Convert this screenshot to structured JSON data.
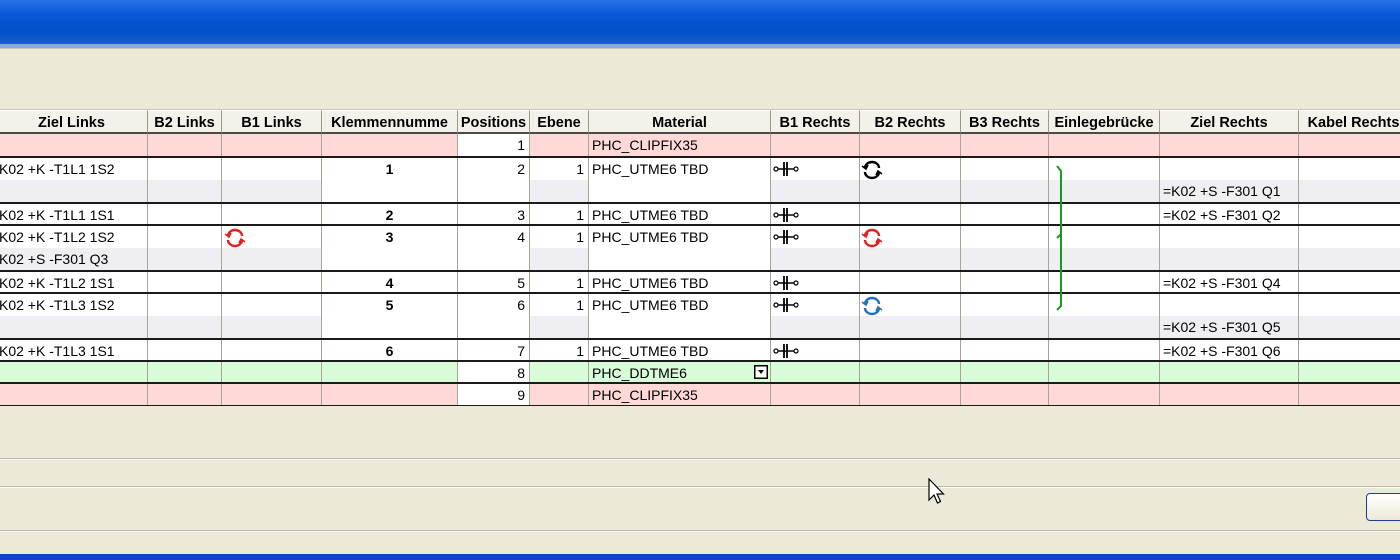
{
  "columns": [
    "Ziel Links",
    "B2 Links",
    "B1 Links",
    "Klemmennumme",
    "Positions",
    "Ebene",
    "Material",
    "B1 Rechts",
    "B2 Rechts",
    "B3 Rechts",
    "Einlegebrücke",
    "Ziel Rechts",
    "Kabel Rechts"
  ],
  "rows": [
    {
      "type": "pink",
      "position": "1",
      "material": "PHC_CLIPFIX35"
    },
    {
      "type": "terminal",
      "ziel_links": [
        "K02 +K -T1L1 1S2",
        ""
      ],
      "klemme": "1",
      "position": "2",
      "ebene": "1",
      "material": "PHC_UTME6 TBD",
      "ziel_rechts": [
        "",
        "=K02 +S -F301 Q1"
      ],
      "b2_rechts_icon": "black-jumper-icon"
    },
    {
      "type": "terminal",
      "ziel_links": [
        "K02 +K -T1L1 1S1"
      ],
      "klemme": "2",
      "position": "3",
      "ebene": "1",
      "material": "PHC_UTME6 TBD",
      "ziel_rechts": [
        "=K02 +S -F301 Q2"
      ]
    },
    {
      "type": "terminal",
      "ziel_links": [
        "K02 +K -T1L2 1S2",
        "K02 +S -F301 Q3"
      ],
      "klemme": "3",
      "position": "4",
      "ebene": "1",
      "material": "PHC_UTME6 TBD",
      "ziel_rechts": [
        "",
        ""
      ],
      "b1_links_icon": "red-jumper-icon",
      "b2_rechts_icon": "red-jumper-icon"
    },
    {
      "type": "terminal",
      "ziel_links": [
        "K02 +K -T1L2 1S1"
      ],
      "klemme": "4",
      "position": "5",
      "ebene": "1",
      "material": "PHC_UTME6 TBD",
      "ziel_rechts": [
        "=K02 +S -F301 Q4"
      ]
    },
    {
      "type": "terminal",
      "ziel_links": [
        "K02 +K -T1L3 1S2",
        ""
      ],
      "klemme": "5",
      "position": "6",
      "ebene": "1",
      "material": "PHC_UTME6 TBD",
      "ziel_rechts": [
        "",
        "=K02 +S -F301 Q5"
      ],
      "b2_rechts_icon": "blue-jumper-icon"
    },
    {
      "type": "terminal",
      "ziel_links": [
        "K02 +K -T1L3 1S1"
      ],
      "klemme": "6",
      "position": "7",
      "ebene": "1",
      "material": "PHC_UTME6 TBD",
      "ziel_rechts": [
        "=K02 +S -F301 Q6"
      ]
    },
    {
      "type": "green",
      "position": "8",
      "material": "PHC_DDTME6"
    },
    {
      "type": "pink",
      "position": "9",
      "material": "PHC_CLIPFIX35"
    }
  ],
  "icons": {
    "terminal": "terminal-connection-icon",
    "bridge": "green-bridge-icon",
    "dropdown": "dropdown-arrow-icon",
    "cursor": "mouse-pointer-icon"
  },
  "colors": {
    "title_bar": "#0050c8",
    "accessory_row": "#ffd8d8",
    "end_plate_row": "#d8fbd8",
    "bridge": "#1a9a1a",
    "red_jumper": "#e02020",
    "blue_jumper": "#2070c0"
  }
}
